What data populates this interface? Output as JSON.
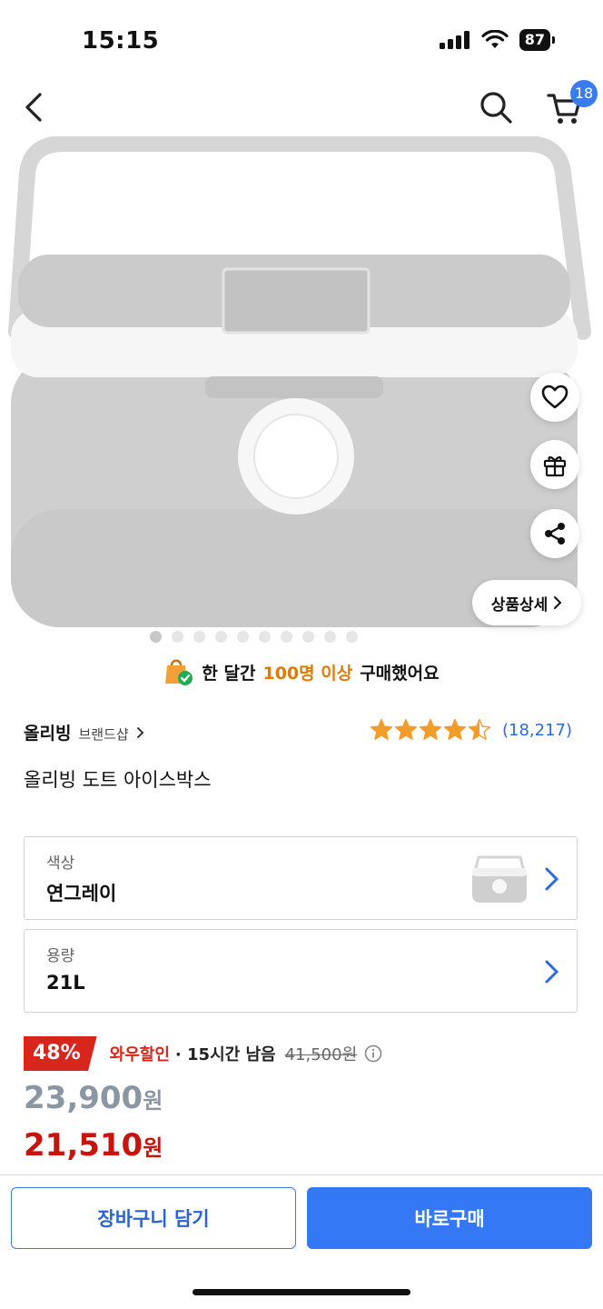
{
  "status_bar": {
    "time": "15:15",
    "battery": "87"
  },
  "nav": {
    "cart_count": "18",
    "icons": [
      "back-icon",
      "search-icon",
      "cart-icon"
    ]
  },
  "side_buttons": {
    "detail_label": "상품상세",
    "icons": [
      "heart-icon",
      "gift-icon",
      "share-icon"
    ]
  },
  "carousel": {
    "total": 10,
    "active_index": 0
  },
  "notice": {
    "prefix": "한 달간",
    "highlight": "100명 이상",
    "suffix": "구매했어요"
  },
  "brand": {
    "name": "올리빙",
    "shop_label": "브랜드샵"
  },
  "rating": {
    "stars": 4.5,
    "count": "(18,217)"
  },
  "product": {
    "title": "올리빙 도트 아이스박스"
  },
  "options": [
    {
      "label": "색상",
      "value": "연그레이"
    },
    {
      "label": "용량",
      "value": "21L"
    }
  ],
  "price": {
    "discount": "48%",
    "wow_label": "와우할인",
    "remaining": "· 15시간 남음",
    "original": "41,500원",
    "sale_number": "23,900",
    "wow_number": "21,510",
    "currency": "원"
  },
  "buttons": {
    "add_to_cart": "장바구니 담기",
    "buy_now": "바로구매"
  },
  "colors": {
    "accent": "#3478f6",
    "sale": "#d9261c",
    "highlight": "#e07a00",
    "star": "#f39c2b"
  }
}
